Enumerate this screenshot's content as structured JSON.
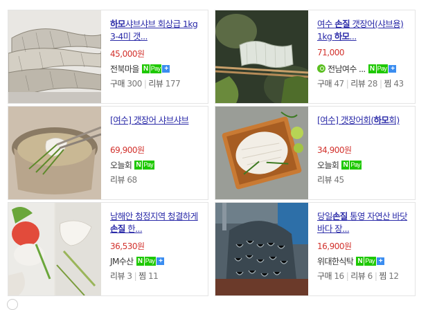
{
  "products": [
    {
      "title_bold": "하모",
      "title_rest": "샤브샤브 회상급 1kg 3-4미 갯...",
      "price": "45,000원",
      "seller": "전북마을",
      "npay": true,
      "plus": true,
      "apple": false,
      "stats": [
        {
          "label": "구매",
          "value": "300"
        },
        {
          "label": "리뷰",
          "value": "177"
        }
      ]
    },
    {
      "title_pre": "여수 ",
      "title_bold": "손질",
      "title_mid": " 갯장어(샤브용) 1kg ",
      "title_bold2": "하모",
      "title_rest": "...",
      "price": "71,000",
      "seller": "전남여수 ...",
      "npay": true,
      "plus": true,
      "apple": true,
      "stats": [
        {
          "label": "구매",
          "value": "47"
        },
        {
          "label": "리뷰",
          "value": "28"
        },
        {
          "label": "찜",
          "value": "43"
        }
      ]
    },
    {
      "title_rest": "[여수] 갯장어 샤브샤브",
      "price": "69,900원",
      "seller": "오늘회",
      "npay": true,
      "plus": false,
      "apple": false,
      "stats": [
        {
          "label": "리뷰",
          "value": "68"
        }
      ]
    },
    {
      "title_pre": "[여수] 갯장어회(",
      "title_bold": "하모",
      "title_rest": "회)",
      "price": "34,900원",
      "seller": "오늘회",
      "npay": true,
      "plus": false,
      "apple": false,
      "stats": [
        {
          "label": "리뷰",
          "value": "45"
        }
      ]
    },
    {
      "title_pre": "남해안 청정지역 청결하게 ",
      "title_bold": "손질",
      "title_rest": " 한...",
      "price": "36,530원",
      "seller": "JM수산",
      "npay": true,
      "plus": true,
      "apple": false,
      "stats": [
        {
          "label": "리뷰",
          "value": "3"
        },
        {
          "label": "찜",
          "value": "11"
        }
      ]
    },
    {
      "title_pre": "당일",
      "title_bold": "손질",
      "title_rest": " 통영 자연산 바닷 바다 장...",
      "price": "16,900원",
      "seller": "위대한식탁",
      "npay": true,
      "plus": true,
      "apple": false,
      "stats": [
        {
          "label": "구매",
          "value": "16"
        },
        {
          "label": "리뷰",
          "value": "6"
        },
        {
          "label": "찜",
          "value": "12"
        }
      ]
    }
  ],
  "npay_labels": {
    "n": "N",
    "pay": "Pay",
    "plus": "+"
  }
}
